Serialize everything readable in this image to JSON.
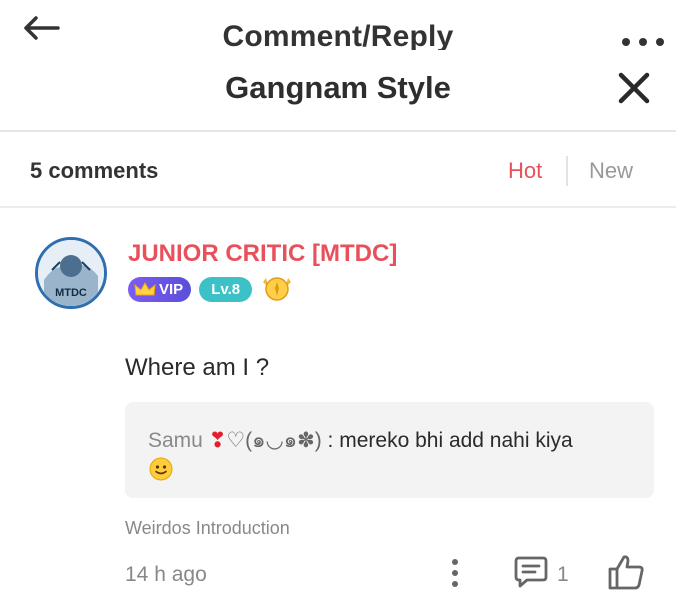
{
  "topbar": {
    "title": "Comment/Reply"
  },
  "header": {
    "title": "Gangnam Style"
  },
  "sort": {
    "count_label": "5 comments",
    "hot_label": "Hot",
    "new_label": "New"
  },
  "comment": {
    "author": "JUNIOR CRITIC [MTDC]",
    "avatar_text": "MTDC",
    "vip_label": "VIP",
    "level_label": "Lv.8",
    "text": "Where am I ?",
    "reply": {
      "name": "Samu",
      "heart": "❣",
      "decoration": "♡(๑◡๑✽)",
      "text": " : mereko bhi add nahi kiya"
    },
    "circle": "Weirdos Introduction",
    "time": "14 h ago",
    "reply_count": "1"
  },
  "colors": {
    "accent": "#e8505b",
    "vip": "#6a55e8",
    "level": "#3cc1c6",
    "muted": "#888888"
  },
  "icons": [
    "back-arrow-icon",
    "more-icon",
    "close-icon",
    "crown-icon",
    "medal-icon",
    "smile-emoji-icon",
    "kebab-icon",
    "comment-icon",
    "like-icon"
  ]
}
